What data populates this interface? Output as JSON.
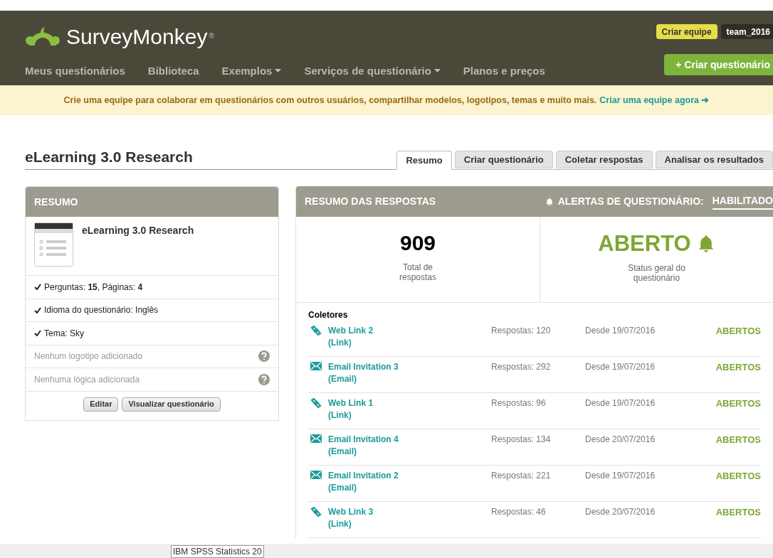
{
  "header": {
    "logo": "SurveyMonkey",
    "logo_mark": "®",
    "nav": [
      {
        "label": "Meus questionários",
        "dropdown": false
      },
      {
        "label": "Biblioteca",
        "dropdown": false
      },
      {
        "label": "Exemplos",
        "dropdown": true
      },
      {
        "label": "Serviços de questionário",
        "dropdown": true
      },
      {
        "label": "Planos e preços",
        "dropdown": false
      }
    ],
    "create_team_button": "Criar equipe",
    "account_button": "team_2016",
    "create_survey_button": "+ Criar questionário"
  },
  "banner": {
    "text": "Crie uma equipe para colaborar em questionários com outros usuários, compartilhar modelos, logotipos, temas e muito mais.",
    "link": "Criar uma equipe agora ➜"
  },
  "survey_title": "eLearning 3.0 Research",
  "tabs": [
    {
      "label": "Resumo",
      "selected": true
    },
    {
      "label": "Criar questionário",
      "selected": false
    },
    {
      "label": "Coletar respostas",
      "selected": false
    },
    {
      "label": "Analisar os resultados",
      "selected": false
    }
  ],
  "summary": {
    "heading": "RESUMO",
    "survey_name": "eLearning 3.0 Research",
    "items": [
      {
        "text": "Perguntas: **15**, Páginas: **4**",
        "done": true
      },
      {
        "text": "Idioma do questionário: Inglês",
        "done": true
      },
      {
        "text": "Tema: Sky",
        "done": true
      },
      {
        "text": "Nenhum logotipo adicionado",
        "done": false
      },
      {
        "text": "Nenhuma lógica adicionada",
        "done": false
      }
    ],
    "buttons": [
      "Editar",
      "Visualizar questionário"
    ]
  },
  "responses": {
    "heading": "RESUMO DAS RESPOSTAS",
    "alerts_label": "ALERTAS DE QUESTIONÁRIO:",
    "alerts_value": "HABILITADO",
    "total": "909",
    "total_label": "Total de respostas",
    "status": "ABERTO",
    "status_label": "Status geral do questionário",
    "collectors_heading": "Coletores",
    "collectors": [
      {
        "kind": "link",
        "name": "Web Link 2",
        "type": "(Link)",
        "responses": "Respostas: 120",
        "since": "Desde 19/07/2016",
        "status": "ABERTOS"
      },
      {
        "kind": "email",
        "name": "Email Invitation 3",
        "type": "(Email)",
        "responses": "Respostas: 292",
        "since": "Desde 19/07/2016",
        "status": "ABERTOS"
      },
      {
        "kind": "link",
        "name": "Web Link 1",
        "type": "(Link)",
        "responses": "Respostas: 96",
        "since": "Desde 19/07/2016",
        "status": "ABERTOS"
      },
      {
        "kind": "email",
        "name": "Email Invitation 4",
        "type": "(Email)",
        "responses": "Respostas: 134",
        "since": "Desde 20/07/2016",
        "status": "ABERTOS"
      },
      {
        "kind": "email",
        "name": "Email Invitation 2",
        "type": "(Email)",
        "responses": "Respostas: 221",
        "since": "Desde 19/07/2016",
        "status": "ABERTOS"
      },
      {
        "kind": "link",
        "name": "Web Link 3",
        "type": "(Link)",
        "responses": "Respostas: 46",
        "since": "Desde 20/07/2016",
        "status": "ABERTOS"
      }
    ]
  },
  "taskbar_tooltip": "IBM SPSS Statistics 20"
}
